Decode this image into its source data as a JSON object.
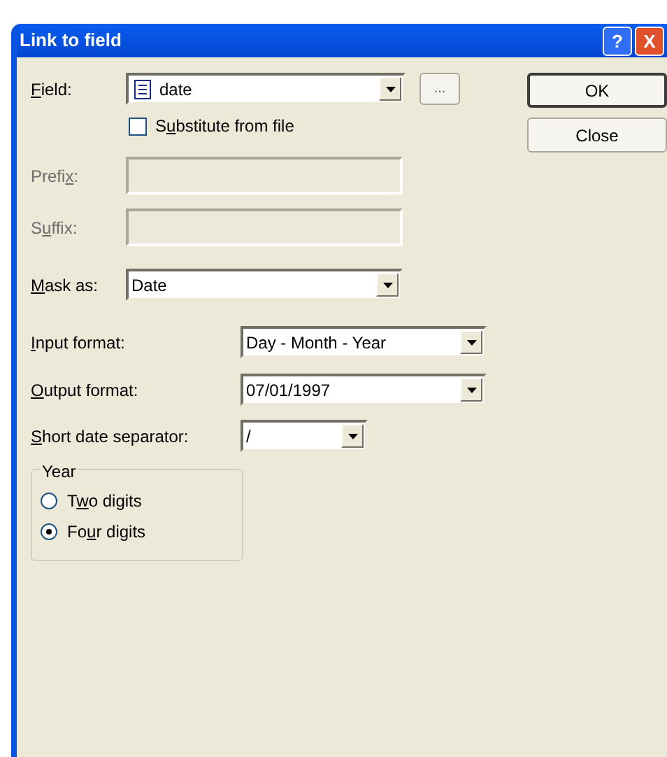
{
  "window": {
    "title": "Link to field",
    "buttons": [
      "?",
      "X"
    ]
  },
  "field": {
    "label_parts": {
      "key": "F",
      "post": "ield:"
    },
    "value": "date",
    "browse": "..."
  },
  "substitute": {
    "label_parts": {
      "pre": "S",
      "key": "u",
      "post": "bstitute from file"
    },
    "checked": false
  },
  "prefix": {
    "label_parts": {
      "pre": "Prefi",
      "key": "x",
      "post": ":"
    },
    "disabled": true
  },
  "suffix": {
    "label_parts": {
      "pre": "S",
      "key": "u",
      "post": "ffix:"
    },
    "disabled": true
  },
  "mask": {
    "label_parts": {
      "key": "M",
      "post": "ask as:"
    },
    "value": "Date"
  },
  "input_format": {
    "label_parts": {
      "key": "I",
      "post": "nput format:"
    },
    "value": "Day - Month - Year"
  },
  "output_format": {
    "label_parts": {
      "key": "O",
      "post": "utput format:"
    },
    "value": "07/01/1997"
  },
  "separator": {
    "label_parts": {
      "key": "S",
      "post": "hort date separator:"
    },
    "value": "/"
  },
  "year": {
    "title": "Year",
    "options": [
      {
        "label_parts": {
          "pre": "T",
          "key": "w",
          "post": "o digits"
        },
        "selected": false
      },
      {
        "label_parts": {
          "pre": "Fo",
          "key": "u",
          "post": "r digits"
        },
        "selected": true
      }
    ]
  },
  "actions": [
    "OK",
    "Close"
  ]
}
